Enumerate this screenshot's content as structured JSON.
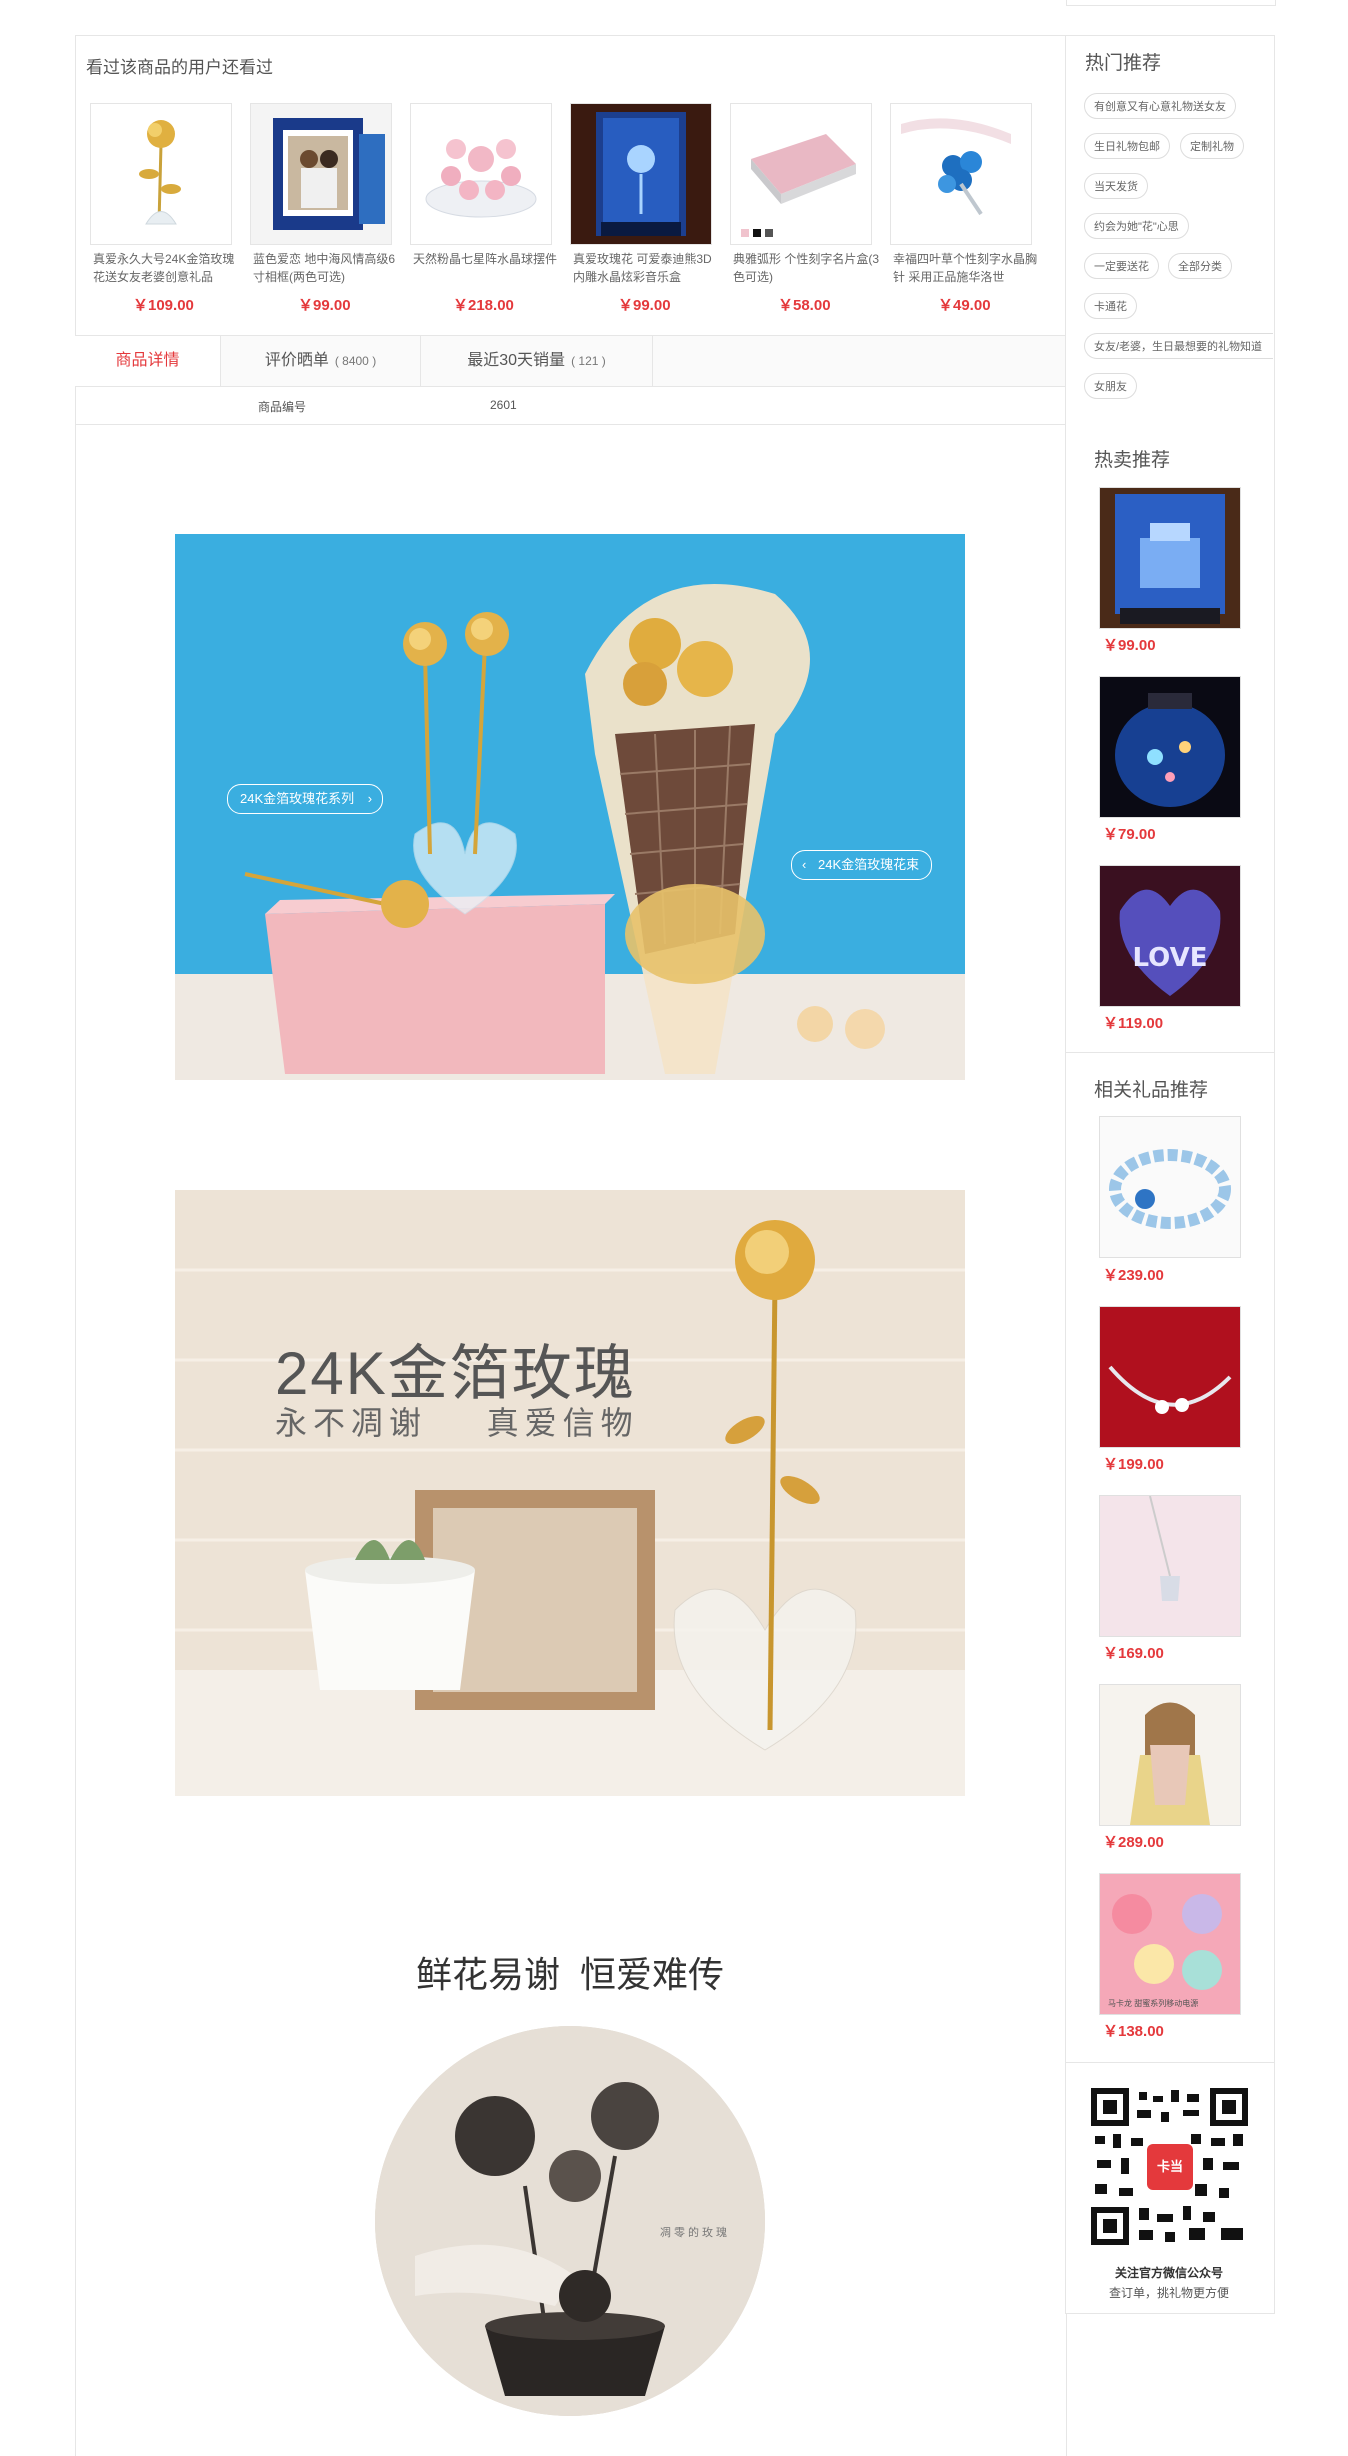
{
  "also_viewed": {
    "title": "看过该商品的用户还看过",
    "items": [
      {
        "name": "真爱永久大号24K金箔玫瑰花送女友老婆创意礼品",
        "price": "￥109.00"
      },
      {
        "name": "蓝色爱恋 地中海风情高级6寸相框(两色可选)",
        "price": "￥99.00"
      },
      {
        "name": "天然粉晶七星阵水晶球摆件",
        "price": "￥218.00"
      },
      {
        "name": "真爱玫瑰花 可爱泰迪熊3D内雕水晶炫彩音乐盒",
        "price": "￥99.00"
      },
      {
        "name": "典雅弧形 个性刻字名片盒(3色可选)",
        "price": "￥58.00"
      },
      {
        "name": "幸福四叶草个性刻字水晶胸针 采用正品施华洛世",
        "price": "￥49.00"
      }
    ]
  },
  "tabs": [
    {
      "label": "商品详情",
      "count": ""
    },
    {
      "label": "评价晒单",
      "count": "( 8400 )"
    },
    {
      "label": "最近30天销量",
      "count": "( 121 )"
    }
  ],
  "spec": {
    "label": "商品编号",
    "value": "2601"
  },
  "banner1": {
    "tag1": "24K金箔玫瑰花系列",
    "tag2": "24K金箔玫瑰花束"
  },
  "banner2": {
    "headline": "24K金箔玫瑰",
    "subline": "永不凋谢    真爱信物"
  },
  "section3": {
    "heading": "鲜花易谢  恒爱难传",
    "circle_text": "凋零的玫瑰"
  },
  "hot_tags": {
    "title": "热门推荐",
    "tags": [
      "有创意又有心意礼物送女友",
      "生日礼物包邮",
      "定制礼物",
      "当天发货",
      "约会为她\"花\"心思",
      "一定要送花",
      "全部分类",
      "卡通花",
      "女友/老婆，生日最想要的礼物知道",
      "女朋友"
    ]
  },
  "hot_sale": {
    "title": "热卖推荐",
    "items": [
      {
        "price": "￥99.00"
      },
      {
        "price": "￥79.00"
      },
      {
        "price": "￥119.00"
      }
    ]
  },
  "related": {
    "title": "相关礼品推荐",
    "items": [
      {
        "price": "￥239.00"
      },
      {
        "price": "￥199.00"
      },
      {
        "price": "￥169.00"
      },
      {
        "price": "￥289.00"
      },
      {
        "price": "￥138.00",
        "caption": "马卡龙 甜蜜系列移动电源"
      }
    ]
  },
  "qr": {
    "line1": "关注官方微信公众号",
    "line2": "查订单，挑礼物更方便",
    "logo": "卡当"
  },
  "colors": {
    "price": "#e4393c",
    "active_tab": "#e4393c",
    "border": "#e6e6e6"
  }
}
